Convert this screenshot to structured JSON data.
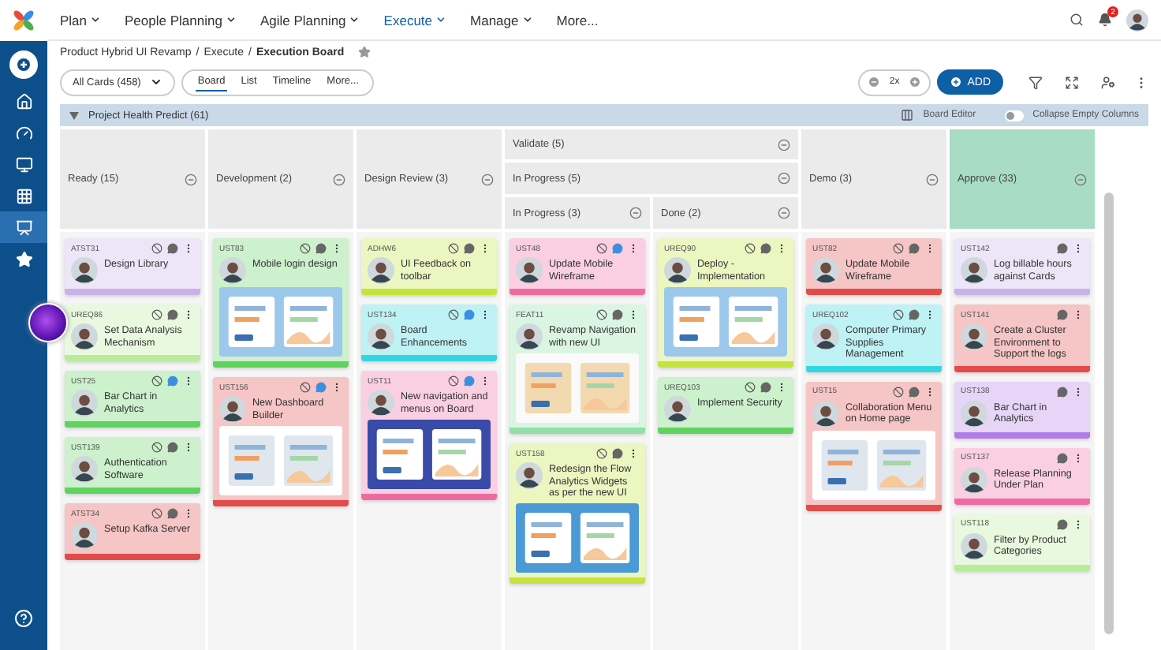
{
  "nav": {
    "items": [
      {
        "label": "Plan",
        "selected": false
      },
      {
        "label": "People Planning",
        "selected": false
      },
      {
        "label": "Agile Planning",
        "selected": false
      },
      {
        "label": "Execute",
        "selected": true
      },
      {
        "label": "Manage",
        "selected": false
      },
      {
        "label": "More...",
        "selected": false
      }
    ],
    "notifications": "2"
  },
  "sidebar": {
    "items": [
      {
        "kind": "home",
        "selected": false
      },
      {
        "kind": "gauge",
        "selected": false
      },
      {
        "kind": "monitor",
        "selected": false
      },
      {
        "kind": "grid",
        "selected": false
      },
      {
        "kind": "board",
        "selected": true
      },
      {
        "kind": "star",
        "selected": false
      }
    ]
  },
  "breadcrumb": [
    {
      "text": "Product Hybrid UI Revamp",
      "kind": "link"
    },
    {
      "text": "/",
      "kind": "separator"
    },
    {
      "text": "Execute",
      "kind": "link"
    },
    {
      "text": "/",
      "kind": "separator"
    },
    {
      "text": "Execution Board",
      "kind": "current"
    }
  ],
  "toolbar": {
    "filter": "All Cards (458)",
    "views": [
      {
        "label": "Board",
        "selected": true
      },
      {
        "label": "List",
        "selected": false
      },
      {
        "label": "Timeline",
        "selected": false
      },
      {
        "label": "More...",
        "selected": false
      }
    ],
    "zoom": "2x",
    "add": "ADD"
  },
  "group": {
    "title": "Project Health Predict (61)",
    "expanded": true,
    "board_editor": "Board Editor",
    "collapse": {
      "label": "Collapse Empty Columns",
      "on": false
    }
  },
  "columns": [
    {
      "kind": "column",
      "title": "Ready (15)",
      "highlighted": false,
      "cards": [
        {
          "id": "ATST31",
          "title": "Design Library",
          "color": "#c8b2e8",
          "blocked": true,
          "unread": false,
          "kind": "plain"
        },
        {
          "id": "UREQ86",
          "title": "Set Data Analysis Mechanism",
          "color": "#b9ec9a",
          "blocked": true,
          "unread": false,
          "kind": "plain"
        },
        {
          "id": "UST25",
          "title": "Bar Chart in Analytics",
          "color": "#5fd35f",
          "blocked": true,
          "unread": true,
          "kind": "plain"
        },
        {
          "id": "UST139",
          "title": "Authentication Software",
          "color": "#5fd35f",
          "blocked": true,
          "unread": false,
          "kind": "plain"
        },
        {
          "id": "ATST34",
          "title": "Setup Kafka Server",
          "color": "#e34b4b",
          "blocked": true,
          "unread": false,
          "kind": "plain"
        }
      ]
    },
    {
      "kind": "column",
      "title": "Development (2)",
      "highlighted": false,
      "cards": [
        {
          "id": "UST83",
          "title": "Mobile login design",
          "color": "#5fd35f",
          "blocked": true,
          "unread": false,
          "kind": "picture"
        },
        {
          "id": "UST156",
          "title": "New Dashboard Builder",
          "color": "#e34b4b",
          "blocked": true,
          "unread": true,
          "kind": "picture"
        }
      ]
    },
    {
      "kind": "column",
      "title": "Design Review (3)",
      "highlighted": false,
      "cards": [
        {
          "id": "ADHW6",
          "title": "UI Feedback on toolbar",
          "color": "#c5e33d",
          "blocked": true,
          "unread": false,
          "kind": "plain"
        },
        {
          "id": "UST134",
          "title": "Board Enhancements",
          "color": "#33d6e0",
          "blocked": true,
          "unread": true,
          "kind": "plain"
        },
        {
          "id": "UST11",
          "title": "New navigation and menus on Board",
          "color": "#f06aa0",
          "blocked": true,
          "unread": true,
          "kind": "picture"
        }
      ]
    },
    {
      "kind": "group",
      "title": "Validate (5)",
      "subtitle": "In Progress (5)",
      "columns": [
        {
          "title": "In Progress (3)",
          "cards": [
            {
              "id": "UST48",
              "title": "Update Mobile Wireframe",
              "color": "#f06aa0",
              "blocked": true,
              "unread": true,
              "kind": "plain"
            },
            {
              "id": "FEAT11",
              "title": "Revamp Navigation with new UI",
              "color": "#8fe0a8",
              "blocked": true,
              "unread": false,
              "kind": "picture"
            },
            {
              "id": "UST158",
              "title": "Redesign the Flow Analytics Widgets as per the new UI",
              "color": "#c5e33d",
              "blocked": true,
              "unread": false,
              "kind": "picture"
            }
          ]
        },
        {
          "title": "Done (2)",
          "cards": [
            {
              "id": "UREQ90",
              "title": "Deploy - Implementation",
              "color": "#c5e33d",
              "blocked": true,
              "unread": false,
              "kind": "picture"
            },
            {
              "id": "UREQ103",
              "title": "Implement Security",
              "color": "#5fd35f",
              "blocked": true,
              "unread": false,
              "kind": "plain"
            }
          ]
        }
      ]
    },
    {
      "kind": "column",
      "title": "Demo (3)",
      "highlighted": false,
      "cards": [
        {
          "id": "UST82",
          "title": "Update Mobile Wireframe",
          "color": "#e34b4b",
          "blocked": true,
          "unread": false,
          "kind": "plain"
        },
        {
          "id": "UREQ102",
          "title": "Computer Primary Supplies Management",
          "color": "#33d6e0",
          "blocked": true,
          "unread": false,
          "kind": "plain"
        },
        {
          "id": "UST15",
          "title": "Collaboration Menu on Home page",
          "color": "#e34b4b",
          "blocked": true,
          "unread": false,
          "kind": "picture"
        }
      ]
    },
    {
      "kind": "column",
      "title": "Approve (33)",
      "highlighted": true,
      "cards": [
        {
          "id": "UST142",
          "title": "Log billable hours against Cards",
          "color": "#c8b2e8",
          "blocked": false,
          "unread": false,
          "kind": "plain"
        },
        {
          "id": "UST141",
          "title": "Create a Cluster Environment to Support the logs",
          "color": "#e34b4b",
          "blocked": false,
          "unread": false,
          "kind": "plain"
        },
        {
          "id": "UST138",
          "title": "Bar Chart in Analytics",
          "color": "#b07ce6",
          "blocked": false,
          "unread": false,
          "kind": "plain"
        },
        {
          "id": "UST137",
          "title": "Release Planning Under Plan",
          "color": "#f06aa0",
          "blocked": false,
          "unread": false,
          "kind": "plain"
        },
        {
          "id": "UST118",
          "title": "Filter by Product Categories",
          "color": "#b9ec9a",
          "blocked": false,
          "unread": false,
          "kind": "plain"
        }
      ]
    }
  ]
}
